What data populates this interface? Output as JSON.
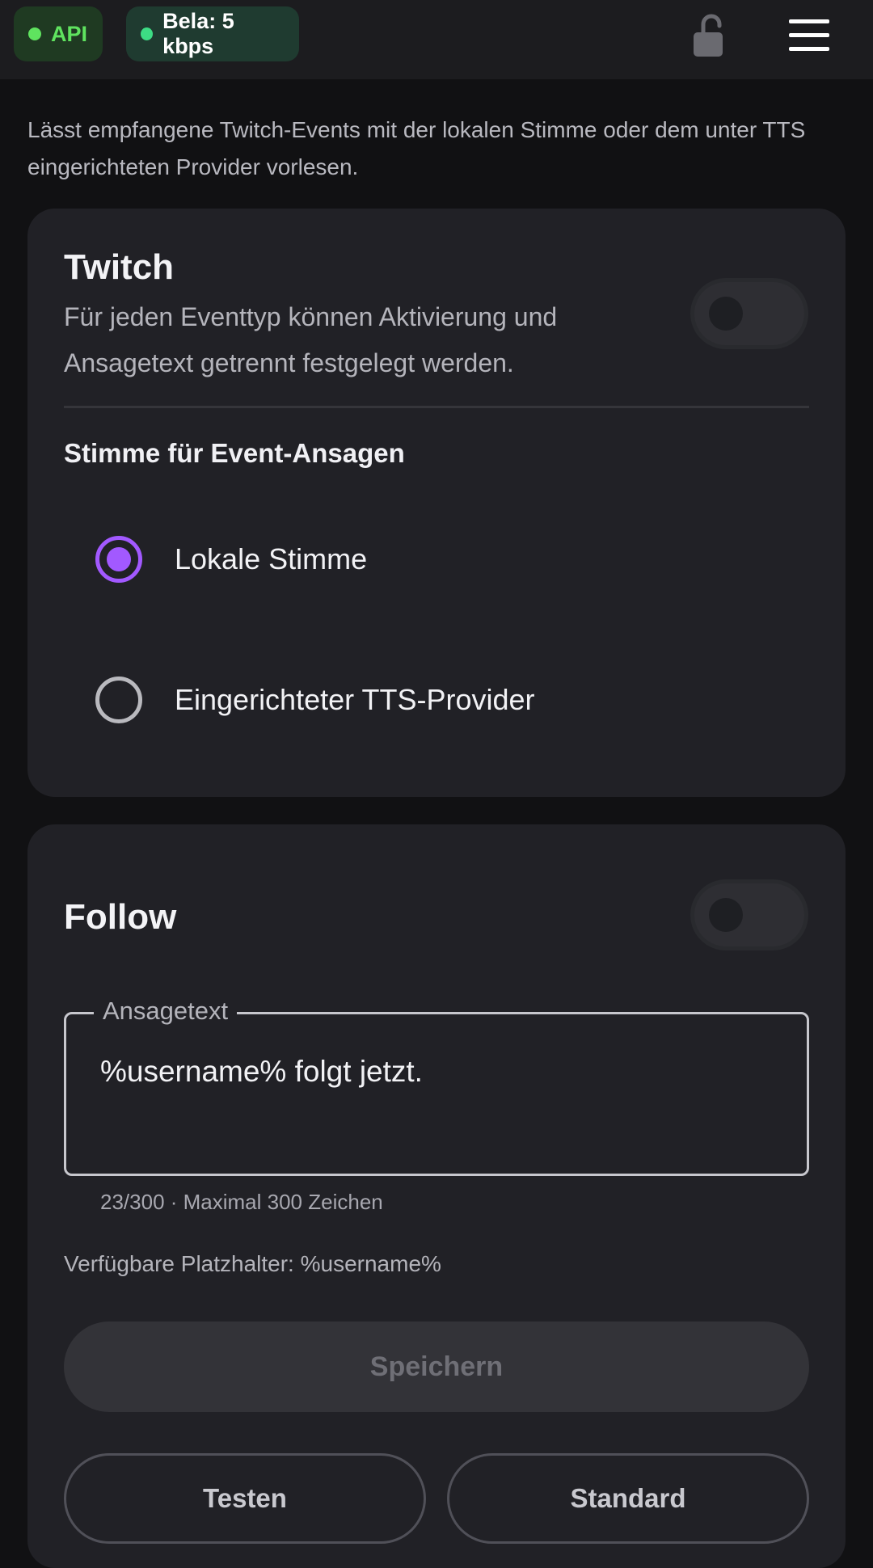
{
  "topbar": {
    "api_label": "API",
    "bitrate_label": "Bela: 5 kbps",
    "api_status_color": "#5fe35f",
    "bitrate_status_color": "#3ddc84",
    "lock_icon": "unlocked-padlock-icon",
    "menu_icon": "hamburger-menu-icon"
  },
  "intro_text": "Lässt empfangene Twitch-Events mit der lokalen Stimme oder dem unter TTS eingerichteten Provider vorlesen.",
  "twitch_card": {
    "title": "Twitch",
    "description": "Für jeden Eventtyp können Aktivierung und Ansagetext getrennt festgelegt werden.",
    "enabled": false,
    "voice_section_label": "Stimme für Event-Ansagen",
    "voice_options": [
      {
        "label": "Lokale Stimme",
        "selected": true
      },
      {
        "label": "Eingerichteter TTS-Provider",
        "selected": false
      }
    ]
  },
  "follow_card": {
    "title": "Follow",
    "enabled": false,
    "field_label": "Ansagetext",
    "field_value": "%username% folgt jetzt.",
    "helper_text": "23/300 · Maximal 300 Zeichen",
    "placeholders_text": "Verfügbare Platzhalter: %username%",
    "save_label": "Speichern",
    "test_label": "Testen",
    "default_label": "Standard"
  },
  "colors": {
    "accent": "#a259ff",
    "background": "#111113",
    "card": "#212126"
  }
}
